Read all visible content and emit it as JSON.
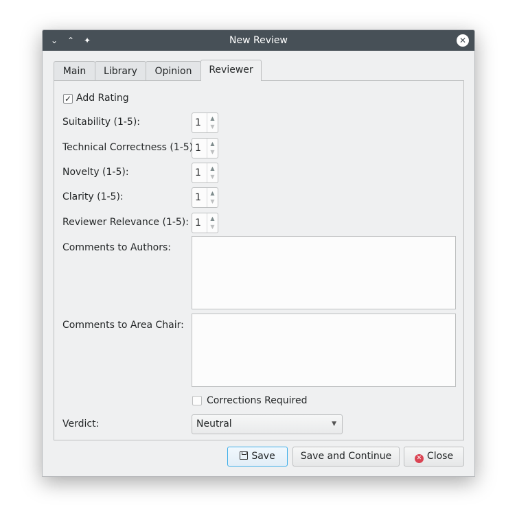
{
  "window": {
    "title": "New Review",
    "icons": [
      "chevron-down-icon",
      "chevron-up-icon",
      "pin-icon",
      "close-icon"
    ]
  },
  "tabs": [
    {
      "label": "Main"
    },
    {
      "label": "Library"
    },
    {
      "label": "Opinion"
    },
    {
      "label": "Reviewer"
    }
  ],
  "active_tab": "Reviewer",
  "form": {
    "add_rating": {
      "label": "Add Rating",
      "checked": true
    },
    "ratings": [
      {
        "label": "Suitability (1-5):",
        "value": "1"
      },
      {
        "label": "Technical Correctness (1-5):",
        "value": "1"
      },
      {
        "label": "Novelty (1-5):",
        "value": "1"
      },
      {
        "label": "Clarity (1-5):",
        "value": "1"
      },
      {
        "label": "Reviewer Relevance (1-5):",
        "value": "1"
      }
    ],
    "comments_authors": {
      "label": "Comments to Authors:",
      "value": ""
    },
    "comments_chair": {
      "label": "Comments to Area Chair:",
      "value": ""
    },
    "corrections": {
      "label": "Corrections Required",
      "checked": false
    },
    "verdict": {
      "label": "Verdict:",
      "value": "Neutral"
    }
  },
  "buttons": {
    "save": "Save",
    "save_continue": "Save and Continue",
    "close": "Close"
  },
  "colors": {
    "titlebar": "#475057",
    "window_bg": "#eff0f1",
    "accent": "#3daee9",
    "close_icon": "#da4453"
  }
}
